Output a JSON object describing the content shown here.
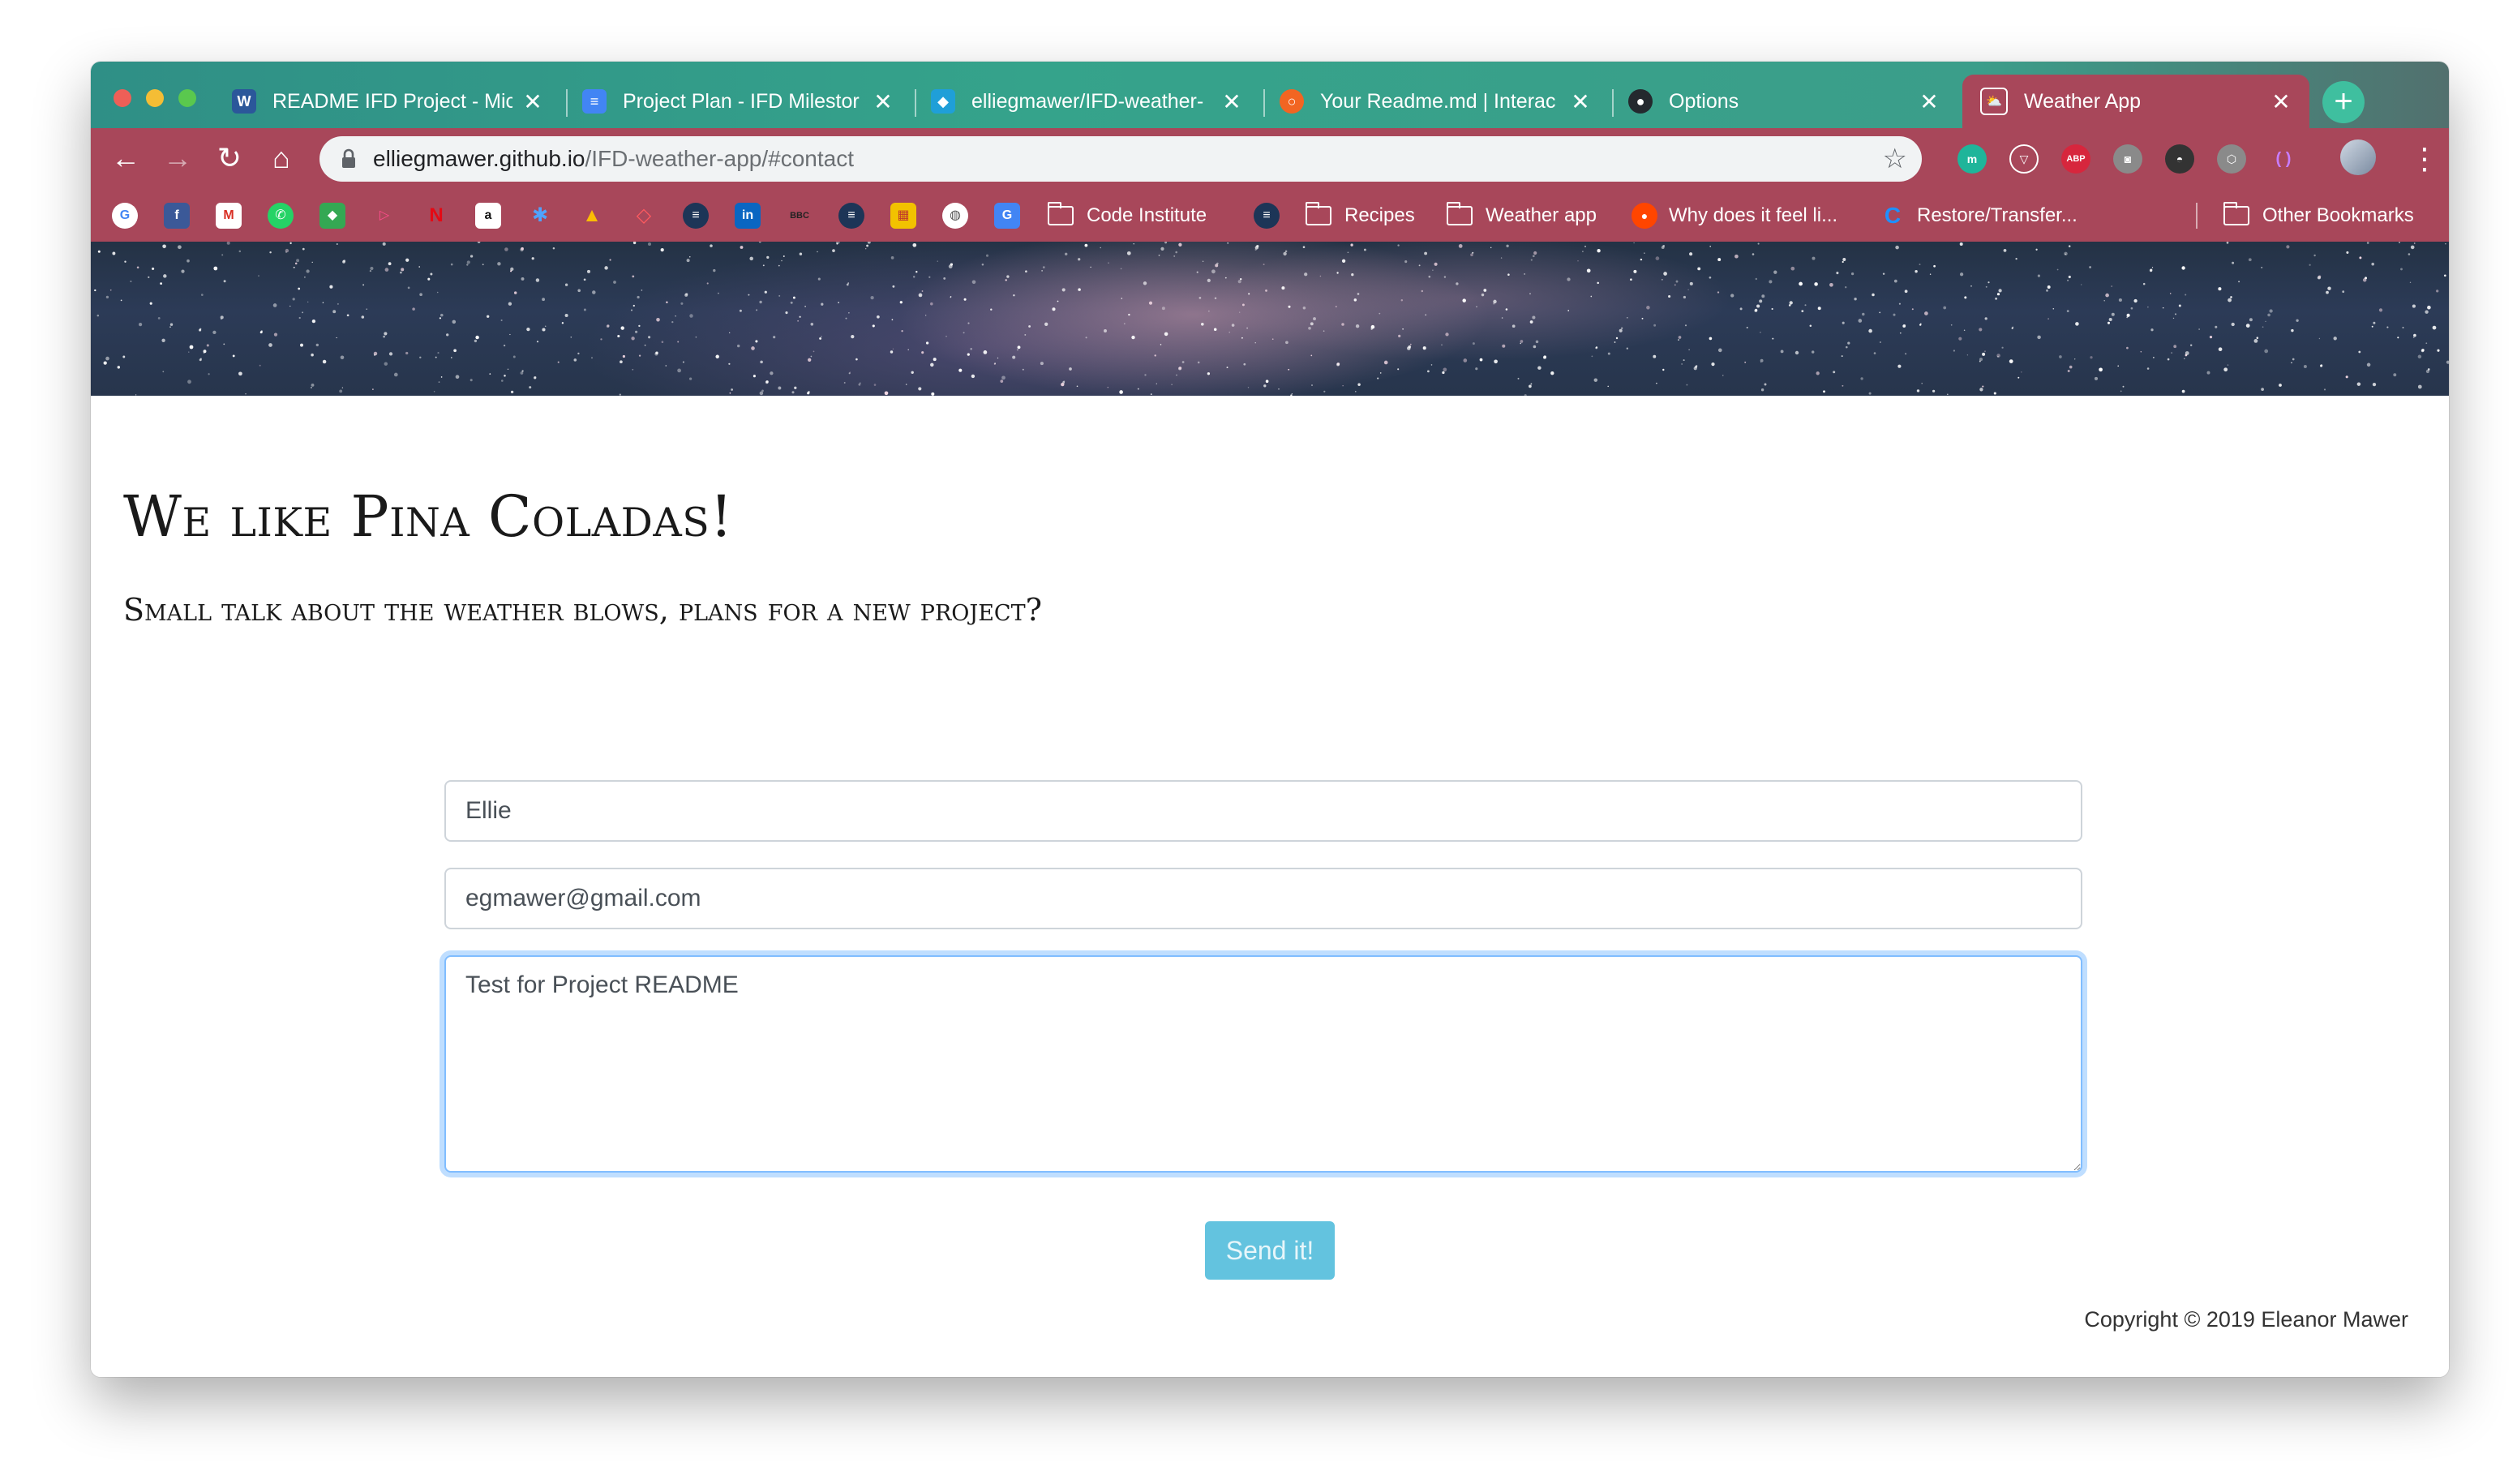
{
  "browser": {
    "tabs": [
      {
        "label": "README IFD Project - Mic",
        "favicon": "W",
        "favicon_color": "#2b579a",
        "active": false
      },
      {
        "label": "Project Plan - IFD Milestor",
        "favicon": "≡",
        "favicon_color": "#4285f4",
        "active": false
      },
      {
        "label": "elliegmawer/IFD-weather-",
        "favicon": "◆",
        "favicon_color": "#1f9fd8",
        "active": false
      },
      {
        "label": "Your Readme.md | Interac",
        "favicon": "○",
        "favicon_color": "#f26522",
        "active": false
      },
      {
        "label": "Options",
        "favicon": "●",
        "favicon_color": "#24292e",
        "active": false
      },
      {
        "label": "Weather App",
        "favicon": "⛅",
        "favicon_color": "#ffffff",
        "active": true
      }
    ],
    "tab_close_glyph": "✕",
    "new_tab_glyph": "+",
    "nav": {
      "back": "←",
      "forward": "→",
      "reload": "↻",
      "home": "⌂"
    },
    "address": {
      "host": "elliegmawer.github.io",
      "path": "/IFD-weather-app/#contact"
    },
    "star_glyph": "☆",
    "menu_glyph": "⋮",
    "extensions": [
      {
        "name": "m-extension-icon",
        "text": "m",
        "color": "#1fb59a"
      },
      {
        "name": "shield-extension-icon",
        "text": "▽",
        "color": "#6e3040"
      },
      {
        "name": "adblock-plus-icon",
        "text": "ABP",
        "color": "#d7263d"
      },
      {
        "name": "camera-extension-icon",
        "text": "◙",
        "color": "#8a8a8a"
      },
      {
        "name": "spy-extension-icon",
        "text": "◓",
        "color": "#333333"
      },
      {
        "name": "cube-extension-icon",
        "text": "⬡",
        "color": "#8a8a8a"
      },
      {
        "name": "brackets-extension-icon",
        "text": "( )",
        "color": "#8a3bd1"
      }
    ],
    "bookmarks": [
      {
        "label": "Code Institute",
        "type": "folder"
      },
      {
        "label": "Recipes",
        "type": "folder"
      },
      {
        "label": "Weather app",
        "type": "folder"
      },
      {
        "label": "Why does it feel li...",
        "type": "reddit"
      },
      {
        "label": "Restore/Transfer...",
        "type": "site"
      },
      {
        "label": "Other Bookmarks",
        "type": "folder"
      }
    ],
    "bookmark_icons": [
      {
        "name": "google-bookmark-icon",
        "text": "G",
        "color": "#4285f4"
      },
      {
        "name": "facebook-bookmark-icon",
        "text": "f",
        "color": "#3b5998"
      },
      {
        "name": "gmail-bookmark-icon",
        "text": "M",
        "color": "#d93025"
      },
      {
        "name": "whatsapp-bookmark-icon",
        "text": "✆",
        "color": "#25d366"
      },
      {
        "name": "maps-bookmark-icon",
        "text": "◆",
        "color": "#34a853"
      },
      {
        "name": "play-bookmark-icon",
        "text": "▷",
        "color": "#e91e63"
      },
      {
        "name": "netflix-bookmark-icon",
        "text": "N",
        "color": "#e50914"
      },
      {
        "name": "amazon-bookmark-icon",
        "text": "a",
        "color": "#111111"
      },
      {
        "name": "gear-bookmark-icon",
        "text": "✱",
        "color": "#1e88e5"
      },
      {
        "name": "drive-bookmark-icon",
        "text": "▲",
        "color": "#fbbc04"
      },
      {
        "name": "airbnb-bookmark-icon",
        "text": "◇",
        "color": "#ff5a5f"
      },
      {
        "name": "rail-bookmark-icon",
        "text": "≡",
        "color": "#1d3557"
      },
      {
        "name": "linkedin-bookmark-icon",
        "text": "in",
        "color": "#0a66c2"
      },
      {
        "name": "bbc-bookmark-icon",
        "text": "BBC",
        "color": "#222222"
      },
      {
        "name": "rail-bookmark-icon-2",
        "text": "≡",
        "color": "#1d3557"
      },
      {
        "name": "lego-bookmark-icon",
        "text": "▦",
        "color": "#f2c200"
      },
      {
        "name": "globe-bookmark-icon",
        "text": "◍",
        "color": "#ffffff"
      },
      {
        "name": "translate-bookmark-icon",
        "text": "G",
        "color": "#4285f4"
      }
    ]
  },
  "page": {
    "heading": "We like Pina Coladas!",
    "subheading": "Small talk about the weather blows, plans for a new project?",
    "form": {
      "name_value": "Ellie",
      "email_value": "egmawer@gmail.com",
      "message_value": "Test for Project README",
      "submit_label": "Send it!"
    },
    "footer": "Copyright © 2019 Eleanor Mawer"
  },
  "colors": {
    "tab_strip": "#35a38b",
    "toolbar": "#a8475a",
    "button": "#5bc0de",
    "focus_border": "#80bdff"
  }
}
